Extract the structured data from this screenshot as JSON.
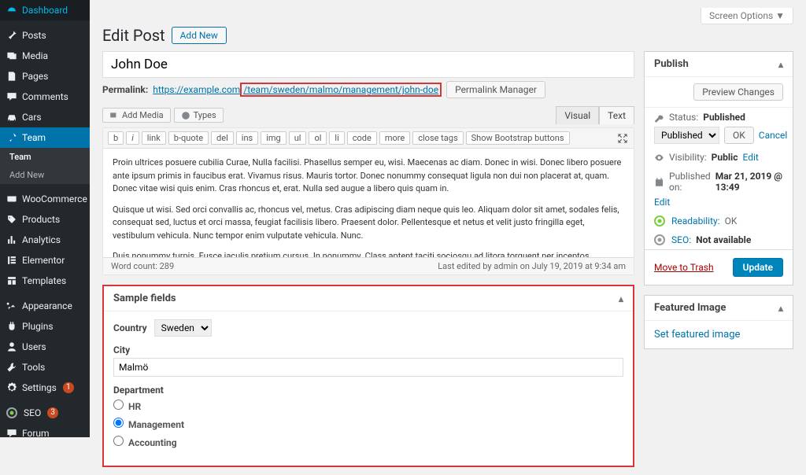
{
  "sidebar": {
    "items": [
      {
        "icon": "dashboard",
        "label": "Dashboard"
      },
      {
        "icon": "pin",
        "label": "Posts"
      },
      {
        "icon": "media",
        "label": "Media"
      },
      {
        "icon": "page",
        "label": "Pages"
      },
      {
        "icon": "comment",
        "label": "Comments"
      },
      {
        "icon": "car",
        "label": "Cars"
      },
      {
        "icon": "team",
        "label": "Team",
        "current": true
      },
      {
        "icon": "woo",
        "label": "WooCommerce"
      },
      {
        "icon": "product",
        "label": "Products"
      },
      {
        "icon": "chart",
        "label": "Analytics"
      },
      {
        "icon": "elementor",
        "label": "Elementor"
      },
      {
        "icon": "template",
        "label": "Templates"
      },
      {
        "icon": "appearance",
        "label": "Appearance"
      },
      {
        "icon": "plugin",
        "label": "Plugins"
      },
      {
        "icon": "user",
        "label": "Users"
      },
      {
        "icon": "tool",
        "label": "Tools"
      },
      {
        "icon": "settings",
        "label": "Settings",
        "badge": "1"
      },
      {
        "icon": "seo",
        "label": "SEO",
        "badge": "3"
      },
      {
        "icon": "forum",
        "label": "Forum"
      }
    ],
    "sub": [
      "Team",
      "Add New"
    ]
  },
  "header": {
    "screen_options": "Screen Options ▼",
    "title": "Edit Post",
    "add_new": "Add New"
  },
  "title_input": "John Doe",
  "permalink": {
    "label": "Permalink:",
    "base": "https://example.com",
    "path": "/team/sweden/malmo/management/john-doe",
    "btn": "Permalink Manager"
  },
  "editor": {
    "add_media": "Add Media",
    "types": "Types",
    "tabs": {
      "visual": "Visual",
      "text": "Text"
    },
    "qt": [
      "b",
      "i",
      "link",
      "b-quote",
      "del",
      "ins",
      "img",
      "ul",
      "ol",
      "li",
      "code",
      "more",
      "close tags",
      "Show Bootstrap buttons"
    ],
    "body": [
      "Proin ultrices posuere cubilia Curae, Nulla facilisi. Phasellus semper eu, wisi. Maecenas ac diam. Donec in wisi. Donec libero posuere ante ipsum primis in faucibus erat. Vivamus risus. Mauris tortor. Donec nonummy consequat ligula non dui non placerat at, quam. Donec vitae wisi quis enim. Cras rhoncus et, erat. Nulla sed augue a libero quis quam in.",
      "Quisque ut wisi. Sed orci convallis ac, rhoncus vel, metus. Cras adipiscing diam neque quis leo. Aliquam dolor sit amet, sodales felis, consequat sed, luctus et orci massa, feugiat facilisis libero. Praesent dolor. Pellentesque et netus et velit justo fringilla eget, vestibulum vehicula. Nunc tempor enim vulputate vehicula. Nunc.",
      "Duis nonummy turpis. Fusce iaculis pretium cursus. In nonummy. Class aptent taciti sociosqu ad litora torquent per inceptos hymenaeos. Curabitur et orci molestie mollis lobortis. In hac habitasse platea dictumst. Duis non enim fringilla sed, congue tristique. Donec nec felis in volutpat non, dictum orci. Mauris viverra quis, libero. Morbi"
    ],
    "word_count_label": "Word count:",
    "word_count": "289",
    "last_edited": "Last edited by admin on July 19, 2019 at 9:34 am"
  },
  "sample_fields": {
    "title": "Sample fields",
    "country_label": "Country",
    "country_value": "Sweden",
    "city_label": "City",
    "city_value": "Malmö",
    "department_label": "Department",
    "departments": [
      "HR",
      "Management",
      "Accounting"
    ],
    "department_selected": "Management"
  },
  "publish": {
    "title": "Publish",
    "preview": "Preview Changes",
    "status_label": "Status:",
    "status": "Published",
    "status_select": "Published",
    "ok": "OK",
    "cancel": "Cancel",
    "visibility_label": "Visibility:",
    "visibility": "Public",
    "edit": "Edit",
    "published_on_label": "Published on:",
    "published_on": "Mar 21, 2019 @ 13:49",
    "readability_label": "Readability:",
    "readability": "OK",
    "seo_label": "SEO:",
    "seo": "Not available",
    "trash": "Move to Trash",
    "update": "Update"
  },
  "featured": {
    "title": "Featured Image",
    "link": "Set featured image"
  }
}
